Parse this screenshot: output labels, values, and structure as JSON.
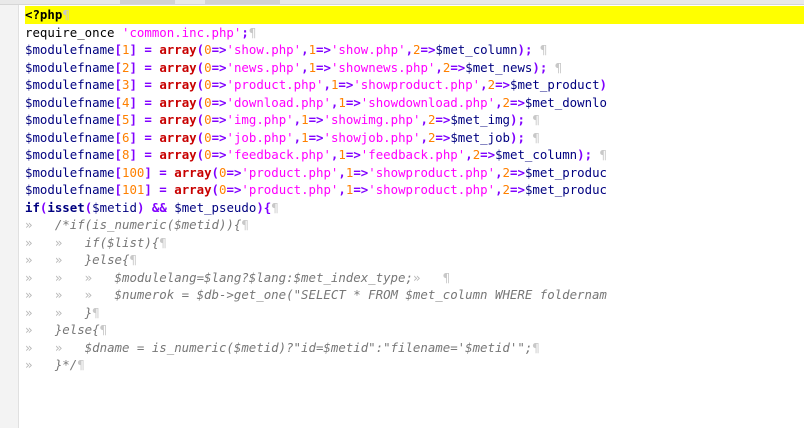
{
  "colors": {
    "current_line_highlight": "#ffff00",
    "keyword": "#c80000",
    "string": "#ff00ff",
    "number": "#ff8000",
    "variable": "#000080",
    "comment": "#777777",
    "whitespace_marker": "#b8b8b8"
  },
  "icons": {
    "eol": "pilcrow",
    "tab": "right-double-angle"
  },
  "editor": {
    "lines": [
      [
        [
          "tag",
          "<?php"
        ],
        [
          "eol",
          "¶"
        ]
      ],
      [
        [
          "pl",
          "require_once "
        ],
        [
          "str",
          "'common.inc.php'"
        ],
        [
          "op",
          ";"
        ],
        [
          "eol",
          "¶"
        ]
      ],
      [
        [
          "var",
          "$modulefname"
        ],
        [
          "op",
          "["
        ],
        [
          "num",
          "1"
        ],
        [
          "op",
          "] = "
        ],
        [
          "kw",
          "array"
        ],
        [
          "op",
          "("
        ],
        [
          "num",
          "0"
        ],
        [
          "op",
          "=>"
        ],
        [
          "str",
          "'show.php'"
        ],
        [
          "op",
          ","
        ],
        [
          "num",
          "1"
        ],
        [
          "op",
          "=>"
        ],
        [
          "str",
          "'show.php'"
        ],
        [
          "op",
          ","
        ],
        [
          "num",
          "2"
        ],
        [
          "op",
          "=>"
        ],
        [
          "var",
          "$met_column"
        ],
        [
          "op",
          ");"
        ],
        [
          "eol",
          " ¶"
        ]
      ],
      [
        [
          "var",
          "$modulefname"
        ],
        [
          "op",
          "["
        ],
        [
          "num",
          "2"
        ],
        [
          "op",
          "] = "
        ],
        [
          "kw",
          "array"
        ],
        [
          "op",
          "("
        ],
        [
          "num",
          "0"
        ],
        [
          "op",
          "=>"
        ],
        [
          "str",
          "'news.php'"
        ],
        [
          "op",
          ","
        ],
        [
          "num",
          "1"
        ],
        [
          "op",
          "=>"
        ],
        [
          "str",
          "'shownews.php'"
        ],
        [
          "op",
          ","
        ],
        [
          "num",
          "2"
        ],
        [
          "op",
          "=>"
        ],
        [
          "var",
          "$met_news"
        ],
        [
          "op",
          ");"
        ],
        [
          "eol",
          " ¶"
        ]
      ],
      [
        [
          "var",
          "$modulefname"
        ],
        [
          "op",
          "["
        ],
        [
          "num",
          "3"
        ],
        [
          "op",
          "] = "
        ],
        [
          "kw",
          "array"
        ],
        [
          "op",
          "("
        ],
        [
          "num",
          "0"
        ],
        [
          "op",
          "=>"
        ],
        [
          "str",
          "'product.php'"
        ],
        [
          "op",
          ","
        ],
        [
          "num",
          "1"
        ],
        [
          "op",
          "=>"
        ],
        [
          "str",
          "'showproduct.php'"
        ],
        [
          "op",
          ","
        ],
        [
          "num",
          "2"
        ],
        [
          "op",
          "=>"
        ],
        [
          "var",
          "$met_product"
        ],
        [
          "op",
          ")"
        ]
      ],
      [
        [
          "var",
          "$modulefname"
        ],
        [
          "op",
          "["
        ],
        [
          "num",
          "4"
        ],
        [
          "op",
          "] = "
        ],
        [
          "kw",
          "array"
        ],
        [
          "op",
          "("
        ],
        [
          "num",
          "0"
        ],
        [
          "op",
          "=>"
        ],
        [
          "str",
          "'download.php'"
        ],
        [
          "op",
          ","
        ],
        [
          "num",
          "1"
        ],
        [
          "op",
          "=>"
        ],
        [
          "str",
          "'showdownload.php'"
        ],
        [
          "op",
          ","
        ],
        [
          "num",
          "2"
        ],
        [
          "op",
          "=>"
        ],
        [
          "var",
          "$met_downlo"
        ]
      ],
      [
        [
          "var",
          "$modulefname"
        ],
        [
          "op",
          "["
        ],
        [
          "num",
          "5"
        ],
        [
          "op",
          "] = "
        ],
        [
          "kw",
          "array"
        ],
        [
          "op",
          "("
        ],
        [
          "num",
          "0"
        ],
        [
          "op",
          "=>"
        ],
        [
          "str",
          "'img.php'"
        ],
        [
          "op",
          ","
        ],
        [
          "num",
          "1"
        ],
        [
          "op",
          "=>"
        ],
        [
          "str",
          "'showimg.php'"
        ],
        [
          "op",
          ","
        ],
        [
          "num",
          "2"
        ],
        [
          "op",
          "=>"
        ],
        [
          "var",
          "$met_img"
        ],
        [
          "op",
          ");"
        ],
        [
          "eol",
          " ¶"
        ]
      ],
      [
        [
          "var",
          "$modulefname"
        ],
        [
          "op",
          "["
        ],
        [
          "num",
          "6"
        ],
        [
          "op",
          "] = "
        ],
        [
          "kw",
          "array"
        ],
        [
          "op",
          "("
        ],
        [
          "num",
          "0"
        ],
        [
          "op",
          "=>"
        ],
        [
          "str",
          "'job.php'"
        ],
        [
          "op",
          ","
        ],
        [
          "num",
          "1"
        ],
        [
          "op",
          "=>"
        ],
        [
          "str",
          "'showjob.php'"
        ],
        [
          "op",
          ","
        ],
        [
          "num",
          "2"
        ],
        [
          "op",
          "=>"
        ],
        [
          "var",
          "$met_job"
        ],
        [
          "op",
          ");"
        ],
        [
          "eol",
          " ¶"
        ]
      ],
      [
        [
          "var",
          "$modulefname"
        ],
        [
          "op",
          "["
        ],
        [
          "num",
          "8"
        ],
        [
          "op",
          "] = "
        ],
        [
          "kw",
          "array"
        ],
        [
          "op",
          "("
        ],
        [
          "num",
          "0"
        ],
        [
          "op",
          "=>"
        ],
        [
          "str",
          "'feedback.php'"
        ],
        [
          "op",
          ","
        ],
        [
          "num",
          "1"
        ],
        [
          "op",
          "=>"
        ],
        [
          "str",
          "'feedback.php'"
        ],
        [
          "op",
          ","
        ],
        [
          "num",
          "2"
        ],
        [
          "op",
          "=>"
        ],
        [
          "var",
          "$met_column"
        ],
        [
          "op",
          ");"
        ],
        [
          "eol",
          " ¶"
        ]
      ],
      [
        [
          "var",
          "$modulefname"
        ],
        [
          "op",
          "["
        ],
        [
          "num",
          "100"
        ],
        [
          "op",
          "] = "
        ],
        [
          "kw",
          "array"
        ],
        [
          "op",
          "("
        ],
        [
          "num",
          "0"
        ],
        [
          "op",
          "=>"
        ],
        [
          "str",
          "'product.php'"
        ],
        [
          "op",
          ","
        ],
        [
          "num",
          "1"
        ],
        [
          "op",
          "=>"
        ],
        [
          "str",
          "'showproduct.php'"
        ],
        [
          "op",
          ","
        ],
        [
          "num",
          "2"
        ],
        [
          "op",
          "=>"
        ],
        [
          "var",
          "$met_produc"
        ]
      ],
      [
        [
          "var",
          "$modulefname"
        ],
        [
          "op",
          "["
        ],
        [
          "num",
          "101"
        ],
        [
          "op",
          "] = "
        ],
        [
          "kw",
          "array"
        ],
        [
          "op",
          "("
        ],
        [
          "num",
          "0"
        ],
        [
          "op",
          "=>"
        ],
        [
          "str",
          "'product.php'"
        ],
        [
          "op",
          ","
        ],
        [
          "num",
          "1"
        ],
        [
          "op",
          "=>"
        ],
        [
          "str",
          "'showproduct.php'"
        ],
        [
          "op",
          ","
        ],
        [
          "num",
          "2"
        ],
        [
          "op",
          "=>"
        ],
        [
          "var",
          "$met_produc"
        ]
      ],
      [
        [
          "kw2",
          "if"
        ],
        [
          "op",
          "("
        ],
        [
          "kw2",
          "isset"
        ],
        [
          "op",
          "("
        ],
        [
          "var",
          "$metid"
        ],
        [
          "op",
          ") && "
        ],
        [
          "var",
          "$met_pseudo"
        ],
        [
          "op",
          "){"
        ],
        [
          "eol",
          "¶"
        ]
      ],
      [
        [
          "tab",
          "»   "
        ],
        [
          "comment",
          "/*if(is_numeric($metid)){"
        ],
        [
          "eol",
          "¶"
        ]
      ],
      [
        [
          "tab",
          "»   »   "
        ],
        [
          "comment",
          "if($list){"
        ],
        [
          "eol",
          "¶"
        ]
      ],
      [
        [
          "tab",
          "»   »   "
        ],
        [
          "comment",
          "}else{"
        ],
        [
          "eol",
          "¶"
        ]
      ],
      [
        [
          "tab",
          "»   »   »   "
        ],
        [
          "comment",
          "$modulelang=$lang?$lang:$met_index_type;"
        ],
        [
          "tab",
          "»   "
        ],
        [
          "eol",
          "¶"
        ]
      ],
      [
        [
          "tab",
          "»   »   »   "
        ],
        [
          "comment",
          "$numerok = $db->get_one(\"SELECT * FROM $met_column WHERE foldernam"
        ]
      ],
      [
        [
          "tab",
          "»   »   "
        ],
        [
          "comment",
          "}"
        ],
        [
          "eol",
          "¶"
        ]
      ],
      [
        [
          "tab",
          "»   "
        ],
        [
          "comment",
          "}else{"
        ],
        [
          "eol",
          "¶"
        ]
      ],
      [
        [
          "tab",
          "»   »   "
        ],
        [
          "comment",
          "$dname = is_numeric($metid)?\"id=$metid\":\"filename='$metid'\";"
        ],
        [
          "eol",
          "¶"
        ]
      ],
      [
        [
          "tab",
          "»   "
        ],
        [
          "comment",
          "}*/"
        ],
        [
          "eol",
          "¶"
        ]
      ]
    ]
  }
}
